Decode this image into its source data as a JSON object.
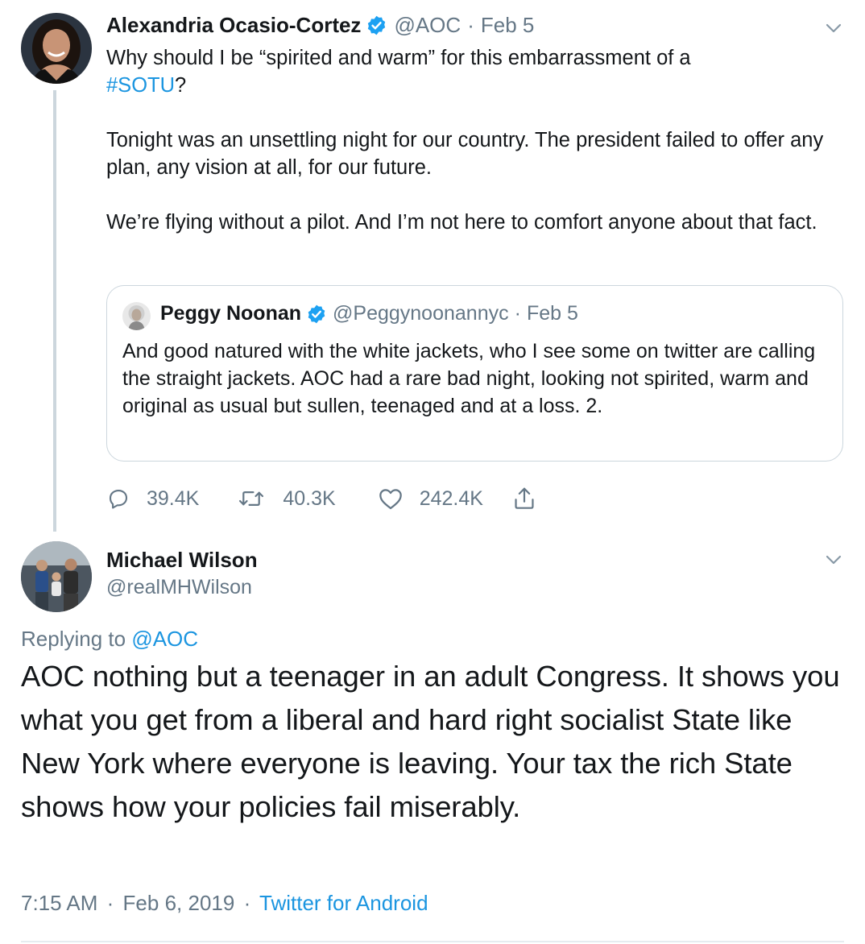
{
  "tweet": {
    "author_name": "Alexandria Ocasio-Cortez",
    "author_handle": "@AOC",
    "separator": "·",
    "date": "Feb 5",
    "text_line1": "Why should I be “spirited and warm” for this embarrassment of a",
    "hashtag": "#SOTU",
    "hashtag_suffix": "?",
    "paragraph2": "Tonight was an unsettling night for our country. The president failed to offer any plan, any vision at all, for our future.",
    "paragraph3": "We’re flying without a pilot. And I’m not here to comfort anyone about that fact.",
    "quoted": {
      "author_name": "Peggy Noonan",
      "author_handle": "@Peggynoonannyc",
      "separator": "·",
      "date": "Feb 5",
      "text": "And good natured with the white jackets, who I see some on twitter are calling the straight jackets. AOC had a rare bad night, looking not spirited, warm and original as usual but sullen, teenaged and at a loss. 2."
    },
    "actions": {
      "replies": "39.4K",
      "retweets": "40.3K",
      "likes": "242.4K"
    }
  },
  "reply": {
    "author_name": "Michael Wilson",
    "author_handle": "@realMHWilson",
    "replying_prefix": "Replying to",
    "replying_to": "@AOC",
    "text": "AOC nothing but a teenager in an adult Congress. It shows you what you get from a liberal and hard right socialist State like New York where everyone is leaving. Your tax the rich State shows how your policies fail miserably.",
    "time": "7:15 AM",
    "separator": "·",
    "date": "Feb 6, 2019",
    "source": "Twitter for Android"
  },
  "colors": {
    "text": "#14171a",
    "secondary": "#657786",
    "link": "#1b95e0",
    "border": "#ccd6dd"
  },
  "icons": [
    "verified-badge-icon",
    "chevron-down-icon",
    "reply-icon",
    "retweet-icon",
    "like-icon",
    "share-icon"
  ]
}
